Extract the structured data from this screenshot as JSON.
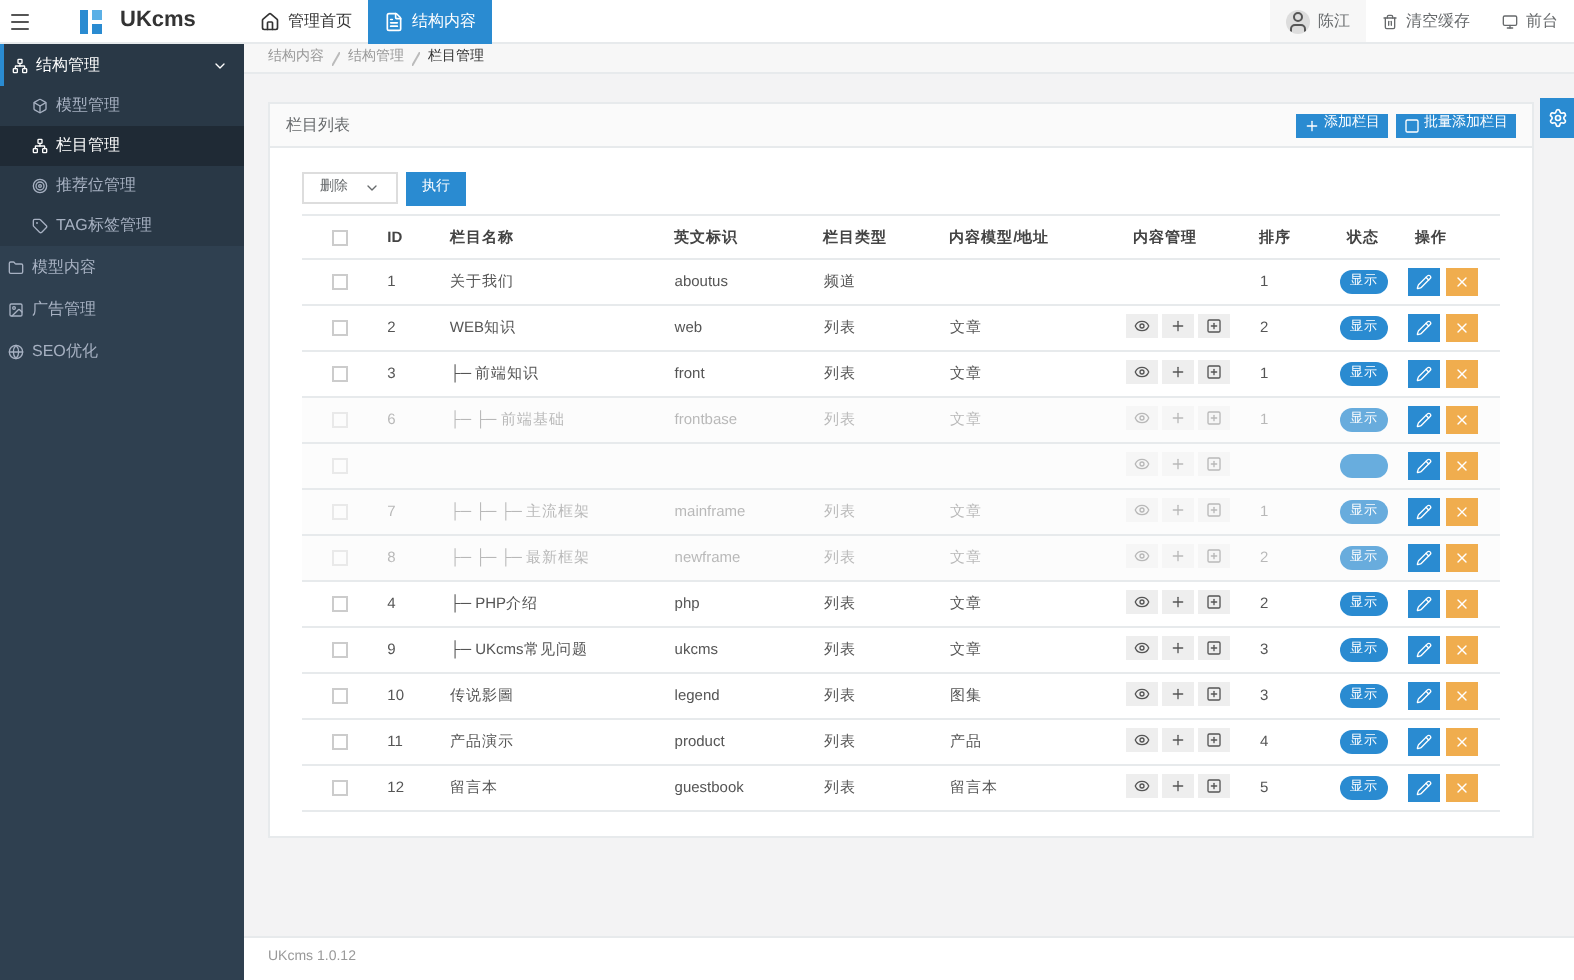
{
  "topbar": {
    "logo": "UKcms",
    "tabs": [
      {
        "label": "管理首页",
        "selected": false
      },
      {
        "label": "结构内容",
        "selected": true
      }
    ],
    "user": "陈江",
    "actions": [
      {
        "label": "清空缓存"
      },
      {
        "label": "前台"
      }
    ]
  },
  "sidebar": {
    "items": [
      {
        "label": "结构管理",
        "expanded": true,
        "children": [
          {
            "label": "模型管理",
            "selected": false
          },
          {
            "label": "栏目管理",
            "selected": true
          },
          {
            "label": "推荐位管理",
            "selected": false
          },
          {
            "label": "TAG标签管理",
            "selected": false
          }
        ]
      },
      {
        "label": "模型内容",
        "expanded": false
      },
      {
        "label": "广告管理",
        "expanded": false
      },
      {
        "label": "SEO优化",
        "expanded": false
      }
    ]
  },
  "breadcrumb": [
    "结构内容",
    "结构管理",
    "栏目管理"
  ],
  "panel": {
    "title": "栏目列表",
    "buttons": [
      {
        "label": "添加栏目"
      },
      {
        "label": "批量添加栏目"
      }
    ],
    "bulk_select": "删除",
    "execute": "执行",
    "select_all_checked": false,
    "columns": [
      "ID",
      "栏目名称",
      "英文标识",
      "栏目类型",
      "内容模型/地址",
      "内容管理",
      "排序",
      "状态",
      "操作"
    ],
    "rows": [
      {
        "id": "1",
        "name": "关于我们",
        "en": "aboutus",
        "type": "频道",
        "sort": "1",
        "manage": false,
        "status": "显示",
        "disabled": false,
        "checked": false
      },
      {
        "id": "2",
        "name": "WEB知识",
        "en": "web",
        "type": "列表",
        "model": "文章",
        "sort": "2",
        "manage": true,
        "status": "显示",
        "disabled": false,
        "checked": false
      },
      {
        "id": "3",
        "name": "├─ 前端知识",
        "en": "front",
        "type": "列表",
        "model": "文章",
        "sort": "1",
        "manage": true,
        "status": "显示",
        "disabled": false,
        "checked": false
      },
      {
        "id": "6",
        "name": "├─ ├─ 前端基础",
        "en": "frontbase",
        "type": "列表",
        "model": "文章",
        "sort": "1",
        "manage": true,
        "status": "显示",
        "disabled": true,
        "checked": false
      },
      {
        "manage": true,
        "disabled": true,
        "checked": false
      },
      {
        "id": "7",
        "name": "├─ ├─ ├─ 主流框架",
        "en": "mainframe",
        "type": "列表",
        "model": "文章",
        "sort": "1",
        "manage": true,
        "status": "显示",
        "disabled": true,
        "checked": false
      },
      {
        "id": "8",
        "name": "├─ ├─ ├─ 最新框架",
        "en": "newframe",
        "type": "列表",
        "model": "文章",
        "sort": "2",
        "manage": true,
        "status": "显示",
        "disabled": true,
        "checked": false
      },
      {
        "id": "4",
        "name": "├─ PHP介绍",
        "en": "php",
        "type": "列表",
        "model": "文章",
        "sort": "2",
        "manage": true,
        "status": "显示",
        "disabled": false,
        "checked": false
      },
      {
        "id": "9",
        "name": "├─ UKcms常见问题",
        "en": "ukcms",
        "type": "列表",
        "model": "文章",
        "sort": "3",
        "manage": true,
        "status": "显示",
        "disabled": false,
        "checked": false
      },
      {
        "id": "10",
        "name": "传说影圖",
        "en": "legend",
        "type": "列表",
        "model": "图集",
        "sort": "3",
        "manage": true,
        "status": "显示",
        "disabled": false,
        "checked": false
      },
      {
        "id": "11",
        "name": "产品演示",
        "en": "product",
        "type": "列表",
        "model": "产品",
        "sort": "4",
        "manage": true,
        "status": "显示",
        "disabled": false,
        "checked": false
      },
      {
        "id": "12",
        "name": "留言本",
        "en": "guestbook",
        "type": "列表",
        "model": "留言本",
        "sort": "5",
        "manage": true,
        "status": "显示",
        "disabled": false,
        "checked": false
      }
    ]
  },
  "footer": "UKcms 1.0.12"
}
